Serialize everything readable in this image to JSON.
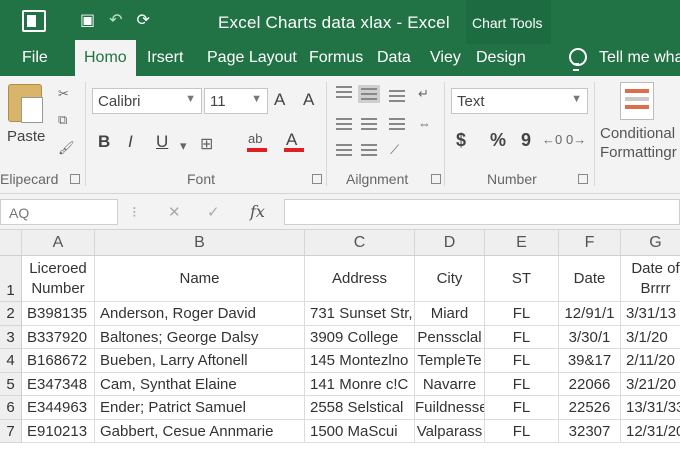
{
  "titlebar": {
    "title": "Excel Charts data xlax  -  Excel",
    "context_tab_group": "Chart Tools"
  },
  "tabs": [
    {
      "label": "File",
      "active": false
    },
    {
      "label": "Homo",
      "active": true
    },
    {
      "label": "Irsert",
      "active": false
    },
    {
      "label": "Page Layout",
      "active": false
    },
    {
      "label": "Formus",
      "active": false
    },
    {
      "label": "Data",
      "active": false
    },
    {
      "label": "Viey",
      "active": false
    },
    {
      "label": "Design",
      "active": false
    }
  ],
  "tell_me": "Tell me wha",
  "ribbon": {
    "clipboard": {
      "paste_label": "Paste",
      "group_label": "Elipecard"
    },
    "font": {
      "font_name": "Calibri",
      "font_size": "11",
      "grow_label": "A",
      "shrink_label": "A",
      "bold": "B",
      "italic": "I",
      "underline": "U",
      "fill_label": "ab",
      "color_label": "A",
      "group_label": "Font"
    },
    "alignment": {
      "group_label": "Ailgnment"
    },
    "number": {
      "format": "Text",
      "currency": "$",
      "percent": "%",
      "comma": "9",
      "group_label": "Number"
    },
    "styles": {
      "cond_line1": "Conditional",
      "cond_line2": "Formattingr"
    }
  },
  "formula_bar": {
    "name_box": "AQ",
    "fx": "fx",
    "value": ""
  },
  "columns": [
    "A",
    "B",
    "C",
    "D",
    "E",
    "F",
    "G"
  ],
  "row_numbers": [
    "1",
    "2",
    "3",
    "4",
    "5",
    "6",
    "7"
  ],
  "header_row": [
    "Liceroed Number",
    "Name",
    "Address",
    "City",
    "ST",
    "Date",
    "Date of Brrrr"
  ],
  "rows": [
    [
      "B398135",
      "Anderson, Roger David",
      "731 Sunset Str,",
      "Miard",
      "FL",
      "12/91/1",
      "3/31/13"
    ],
    [
      "B337920",
      "Baltones;  George Dalsy",
      "3909 College",
      "Penssclal",
      "FL",
      "3/30/1",
      "3/1/20"
    ],
    [
      "B168672",
      "Bueben, Larry Aftonell",
      "145 Montezlno",
      "TempleTe",
      "FL",
      "39&17",
      "2/11/20"
    ],
    [
      "E347348",
      "Cam, Synthat Elaine",
      "141 Monre c!C",
      "Navarre",
      "FL",
      "22066",
      "3/21/20"
    ],
    [
      "E344963",
      "Ender; Patrict Samuel",
      "2558 Selstical",
      "Fuildnesse",
      "FL",
      "22526",
      "13/31/33"
    ],
    [
      "E910213",
      "Gabbert, Cesue Annmarie",
      "1500 MaScui",
      "Valparass",
      "FL",
      "32307",
      "12/31/20"
    ]
  ],
  "colors": {
    "excel_green": "#217346",
    "ribbon_bg": "#f3f3f3",
    "font_color_red": "#e02020"
  },
  "icons": [
    "excel-logo-icon",
    "save-icon",
    "undo-icon",
    "redo-icon",
    "lightbulb-icon",
    "paste-icon",
    "cut-icon",
    "copy-icon",
    "format-painter-icon",
    "conditional-formatting-icon"
  ]
}
